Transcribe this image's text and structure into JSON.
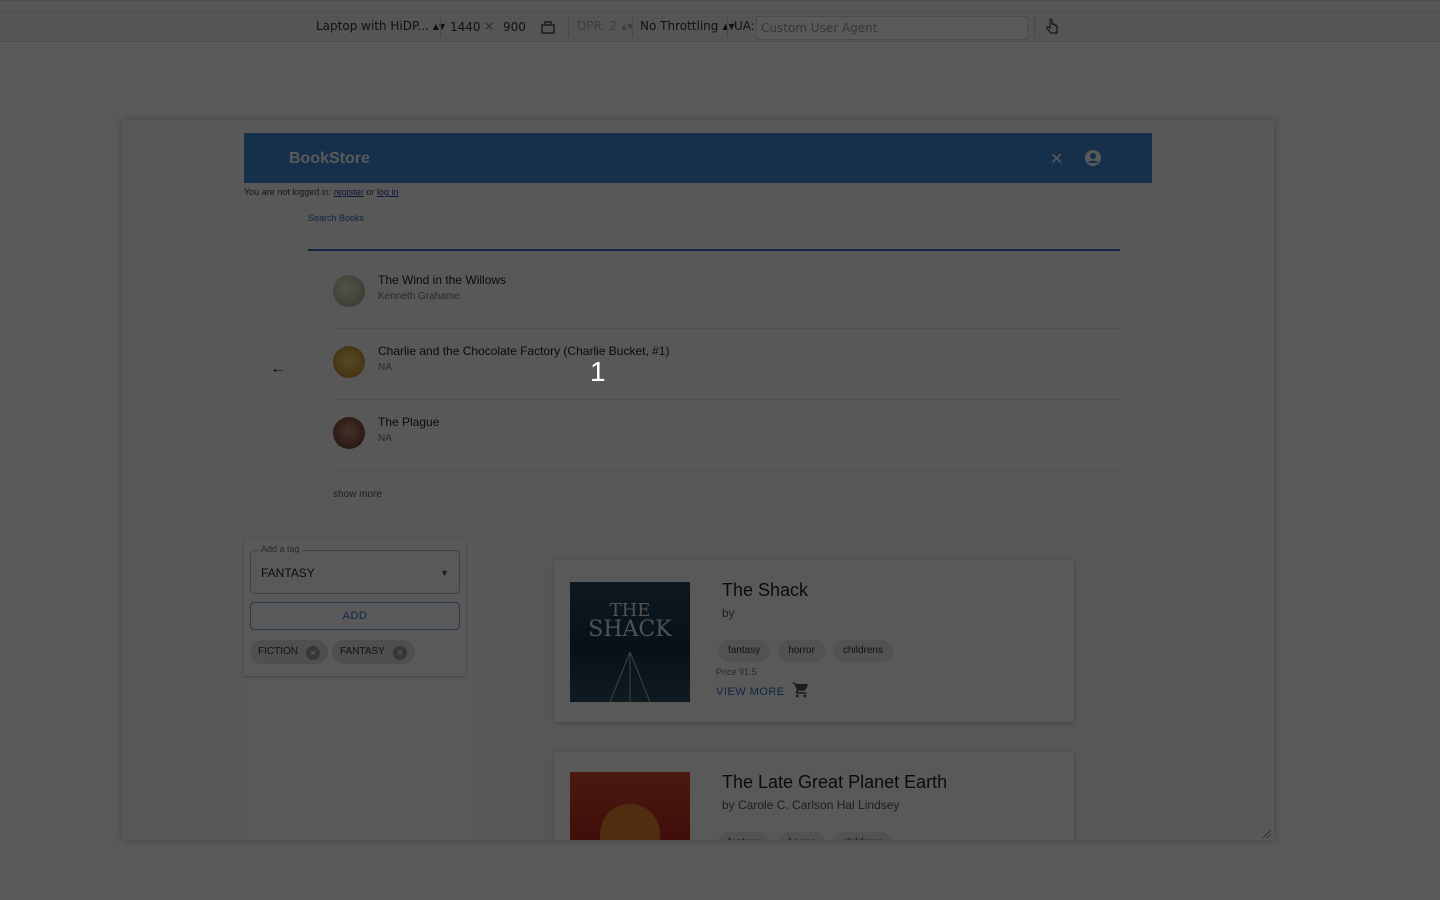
{
  "devtools": {
    "device": "Laptop with HiDP...",
    "width": "1440",
    "times": "×",
    "height": "900",
    "dpr": "DPR: 2",
    "throttling": "No Throttling",
    "ua_label": "UA:",
    "ua_placeholder": "Custom User Agent"
  },
  "app": {
    "title": "BookStore",
    "close_icon": "close-icon",
    "account_icon": "account-circle-icon",
    "brand_color": "#3f88d8",
    "login_note": {
      "prefix": "You are not logged in:",
      "register": "register",
      "or": "or",
      "login": "log in"
    }
  },
  "search": {
    "label": "Search Books",
    "results": [
      {
        "title": "The Wind in the Willows",
        "author": "Kenneth Grahame",
        "thumb_color": "#c9c2a6"
      },
      {
        "title": "Charlie and the Chocolate Factory (Charlie Bucket, #1)",
        "author": "NA",
        "thumb_color": "#d9a23a"
      },
      {
        "title": "The Plague",
        "author": "NA",
        "thumb_color": "#8e5a4a"
      }
    ],
    "show_more": "show more"
  },
  "overlay": {
    "step": "1"
  },
  "tags": {
    "select_label": "Add a tag",
    "select_value": "FANTASY",
    "add_button": "ADD",
    "chips": [
      "FICTION",
      "FANTASY"
    ]
  },
  "books": [
    {
      "title": "The Shack",
      "author": "by",
      "tags": [
        "fantasy",
        "horror",
        "childrens"
      ],
      "price": "Price 91.5",
      "view_more": "VIEW MORE",
      "cover_color": "#1f3a55"
    },
    {
      "title": "The Late Great Planet Earth",
      "author": "by Carole C. Carlson Hal Lindsey",
      "tags": [
        "fantasy",
        "horror",
        "childrens"
      ],
      "cover_color": "#c0392b"
    }
  ]
}
